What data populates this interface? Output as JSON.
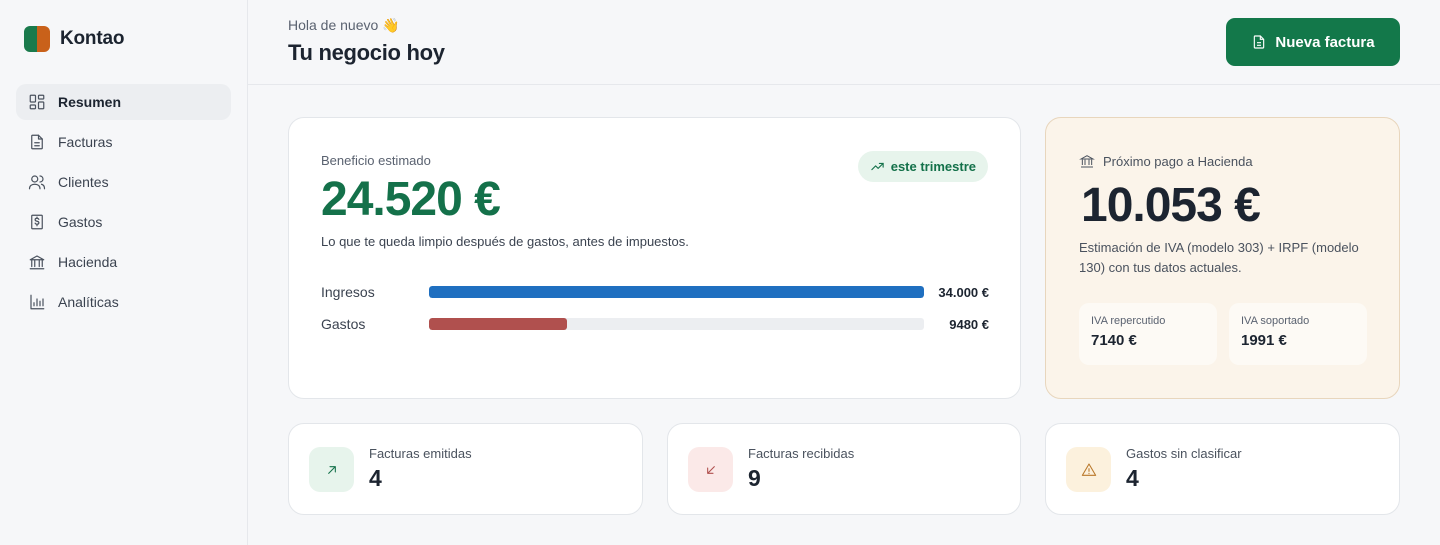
{
  "brand": {
    "name": "Kontao"
  },
  "sidebar": {
    "items": [
      {
        "label": "Resumen",
        "icon": "dashboard-icon",
        "active": true
      },
      {
        "label": "Facturas",
        "icon": "document-icon"
      },
      {
        "label": "Clientes",
        "icon": "users-icon"
      },
      {
        "label": "Gastos",
        "icon": "receipt-dollar-icon"
      },
      {
        "label": "Hacienda",
        "icon": "bank-icon"
      },
      {
        "label": "Analíticas",
        "icon": "bar-chart-icon"
      }
    ]
  },
  "header": {
    "greeting": "Hola de nuevo 👋",
    "title": "Tu negocio hoy",
    "new_invoice_label": "Nueva factura"
  },
  "profit": {
    "label": "Beneficio estimado",
    "amount": "24.520 €",
    "description": "Lo que te queda limpio después de gastos, antes de impuestos.",
    "period_badge": "este trimestre",
    "bars": [
      {
        "label": "Ingresos",
        "value": "34.000 €",
        "fraction": 1.0,
        "color": "#1f6fc0"
      },
      {
        "label": "Gastos",
        "value": "9480 €",
        "fraction": 0.279,
        "color": "#b0504e"
      }
    ]
  },
  "hacienda": {
    "label": "Próximo pago a Hacienda",
    "amount": "10.053 €",
    "description": "Estimación de IVA (modelo 303) + IRPF (modelo 130) con tus datos actuales.",
    "iva_repercutido_label": "IVA repercutido",
    "iva_repercutido_value": "7140 €",
    "iva_soportado_label": "IVA soportado",
    "iva_soportado_value": "1991 €"
  },
  "stats": [
    {
      "label": "Facturas emitidas",
      "value": "4",
      "icon": "arrow-up-right-icon",
      "bg": "#e7f4ec",
      "color": "#14714a"
    },
    {
      "label": "Facturas recibidas",
      "value": "9",
      "icon": "arrow-down-left-icon",
      "bg": "#fbe9e8",
      "color": "#b0504e"
    },
    {
      "label": "Gastos sin clasificar",
      "value": "4",
      "icon": "warning-icon",
      "bg": "#fcf1dd",
      "color": "#b9782a"
    }
  ]
}
